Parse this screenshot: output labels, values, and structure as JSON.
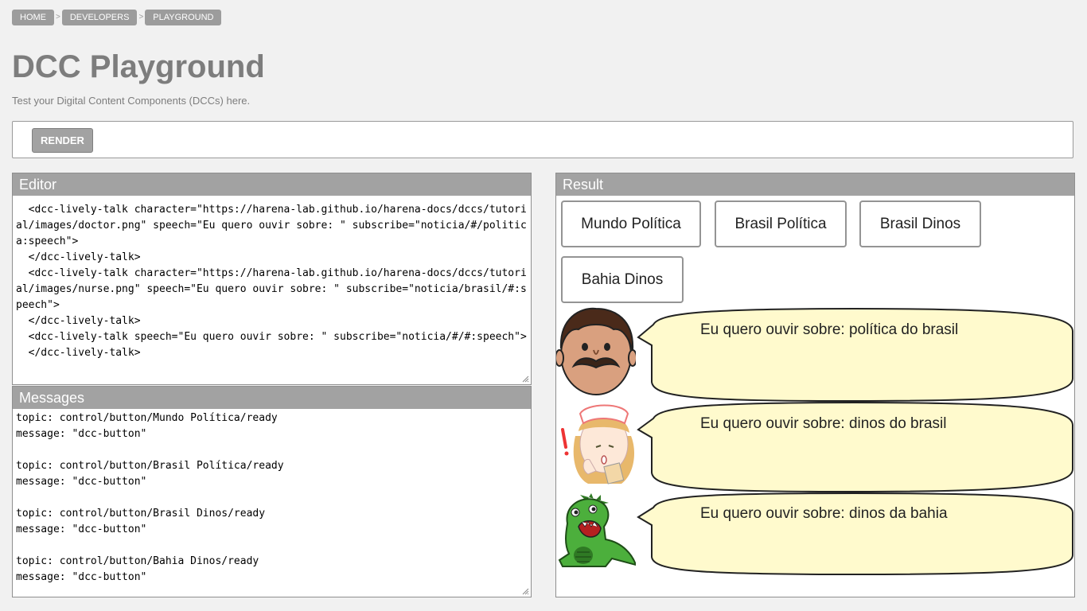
{
  "breadcrumb": [
    {
      "label": "HOME"
    },
    {
      "label": "DEVELOPERS"
    },
    {
      "label": "PLAYGROUND"
    }
  ],
  "breadcrumb_separator": ">",
  "page": {
    "title": "DCC Playground",
    "subtitle": "Test your Digital Content Components (DCCs) here."
  },
  "toolbar": {
    "render_label": "RENDER"
  },
  "editor": {
    "title": "Editor",
    "lines": [
      "  <dcc-lively-talk character=\"https://harena-lab.github.io/harena-docs/dccs/tutorial/images/doctor.png\" speech=\"Eu quero ouvir sobre: \" subscribe=\"noticia/#/politica:speech\">",
      "  </dcc-lively-talk>",
      "  <dcc-lively-talk character=\"https://harena-lab.github.io/harena-docs/dccs/tutorial/images/nurse.png\" speech=\"Eu quero ouvir sobre: \" subscribe=\"noticia/brasil/#:speech\">",
      "  </dcc-lively-talk>",
      "  <dcc-lively-talk speech=\"Eu quero ouvir sobre: \" subscribe=\"noticia/#/#:speech\">",
      "  </dcc-lively-talk>"
    ]
  },
  "messages": {
    "title": "Messages",
    "items": [
      {
        "topic": "topic: control/button/Mundo Política/ready",
        "message": "message: \"dcc-button\""
      },
      {
        "topic": "topic: control/button/Brasil Política/ready",
        "message": "message: \"dcc-button\""
      },
      {
        "topic": "topic: control/button/Brasil Dinos/ready",
        "message": "message: \"dcc-button\""
      },
      {
        "topic": "topic: control/button/Bahia Dinos/ready",
        "message": "message: \"dcc-button\""
      }
    ]
  },
  "result": {
    "title": "Result",
    "buttons": [
      {
        "label": "Mundo Política"
      },
      {
        "label": "Brasil Política"
      },
      {
        "label": "Brasil Dinos"
      },
      {
        "label": "Bahia Dinos"
      }
    ],
    "talks": [
      {
        "character": "doctor-icon",
        "text": "Eu quero ouvir sobre: política do brasil"
      },
      {
        "character": "nurse-icon",
        "text": "Eu quero ouvir sobre: dinos do brasil"
      },
      {
        "character": "dino-icon",
        "text": "Eu quero ouvir sobre: dinos da bahia"
      }
    ]
  },
  "colors": {
    "page_bg": "#f1f1f1",
    "header_bg": "#a2a2a2",
    "title_text": "#7d7d7d",
    "bubble_fill": "#fffacd",
    "dino_green": "#4caf3c"
  }
}
